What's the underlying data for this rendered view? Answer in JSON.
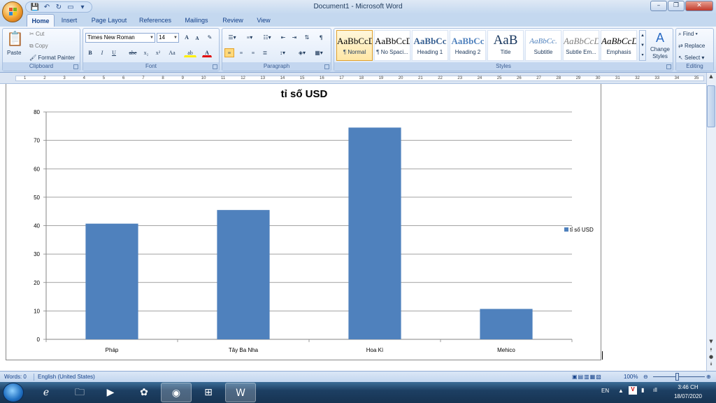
{
  "window": {
    "title": "Document1 - Microsoft Word",
    "minimize": "–",
    "maximize": "❐",
    "close": "✕"
  },
  "tabs": [
    {
      "label": "Home",
      "active": true
    },
    {
      "label": "Insert"
    },
    {
      "label": "Page Layout"
    },
    {
      "label": "References"
    },
    {
      "label": "Mailings"
    },
    {
      "label": "Review"
    },
    {
      "label": "View"
    }
  ],
  "ribbon": {
    "clipboard": {
      "label": "Clipboard",
      "paste": "Paste",
      "cut": "Cut",
      "copy": "Copy",
      "format_painter": "Format Painter"
    },
    "font": {
      "label": "Font",
      "font_name": "Times New Roman",
      "font_size": "14",
      "grow": "A",
      "shrink": "A",
      "clear": "✎",
      "bold": "B",
      "italic": "I",
      "underline": "U",
      "strike": "abe",
      "subscript": "x₂",
      "superscript": "x²",
      "change_case": "Aa",
      "highlight": "ab",
      "font_color": "A"
    },
    "paragraph": {
      "label": "Paragraph",
      "pilcrow": "¶"
    },
    "styles": {
      "label": "Styles",
      "items": [
        {
          "sample": "AaBbCcDc",
          "name": "¶ Normal",
          "selected": true
        },
        {
          "sample": "AaBbCcDc",
          "name": "¶ No Spaci..."
        },
        {
          "sample": "AaBbCc",
          "name": "Heading 1"
        },
        {
          "sample": "AaBbCc",
          "name": "Heading 2"
        },
        {
          "sample": "AaB",
          "name": "Title"
        },
        {
          "sample": "AaBbCc.",
          "name": "Subtitle"
        },
        {
          "sample": "AaBbCcDc",
          "name": "Subtle Em..."
        },
        {
          "sample": "AaBbCcDc",
          "name": "Emphasis"
        }
      ],
      "change_styles": "Change Styles"
    },
    "editing": {
      "label": "Editing",
      "find": "Find",
      "replace": "Replace",
      "select": "Select"
    }
  },
  "ruler_numbers": [
    "1",
    "2",
    "3",
    "4",
    "5",
    "6",
    "7",
    "8",
    "9",
    "10",
    "11",
    "12",
    "13",
    "14",
    "15",
    "16",
    "17",
    "18",
    "19",
    "20",
    "21",
    "22",
    "23",
    "24",
    "25",
    "26",
    "27",
    "28",
    "29",
    "30",
    "31",
    "32",
    "33",
    "34",
    "35"
  ],
  "status": {
    "words": "Words: 0",
    "language": "English (United States)",
    "zoom": "100%"
  },
  "taskbar": {
    "lang": "EN",
    "time": "3:46 CH",
    "date": "18/07/2020"
  },
  "colors": {
    "bar": "#4f81bd",
    "grid": "#858585"
  },
  "chart_data": {
    "type": "bar",
    "title": "tỉ số USD",
    "categories": [
      "Pháp",
      "Tây Ba Nha",
      "Hoa Kì",
      "Mehico"
    ],
    "series": [
      {
        "name": "tỉ số USD",
        "values": [
          40.7,
          45.5,
          74.5,
          10.7
        ]
      }
    ],
    "ylim": [
      0,
      80
    ],
    "yticks": [
      0,
      10,
      20,
      30,
      40,
      50,
      60,
      70,
      80
    ],
    "grid": true,
    "legend": "right"
  }
}
